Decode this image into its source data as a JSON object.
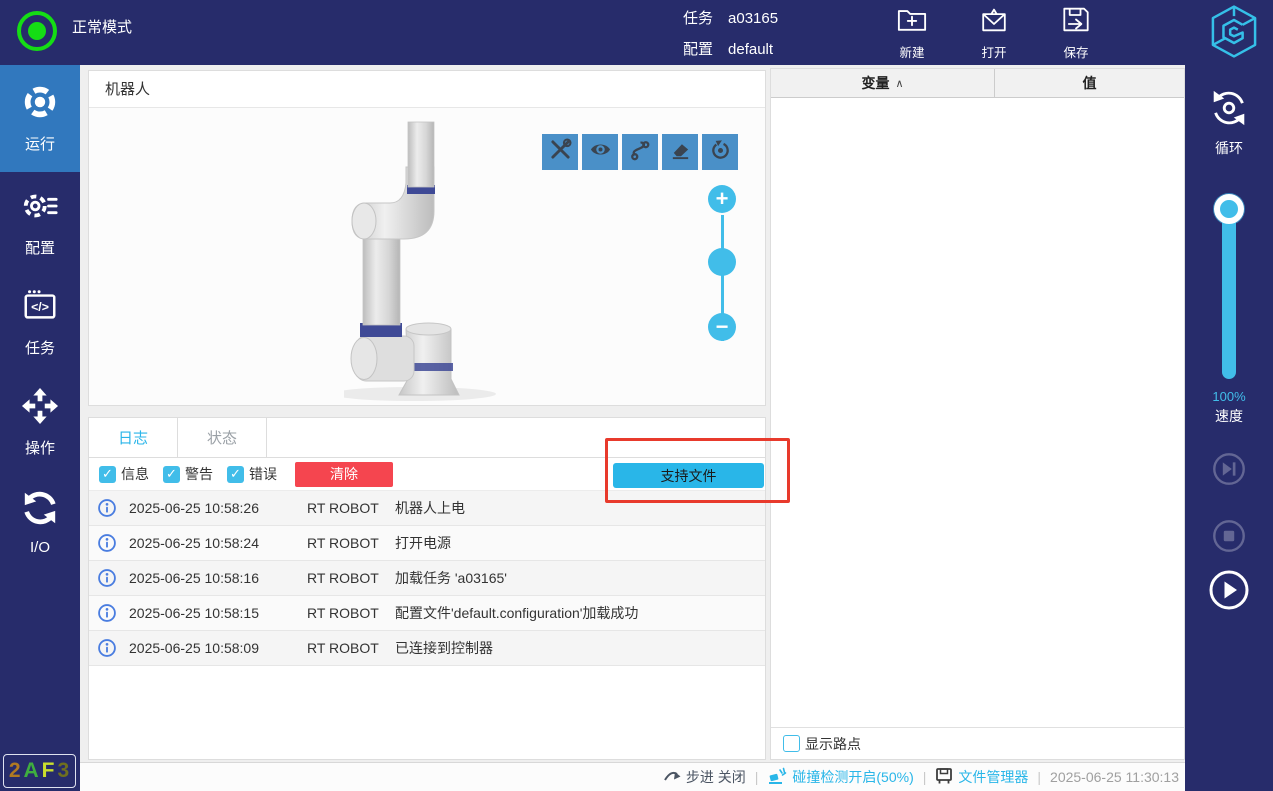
{
  "topbar": {
    "mode_label": "正常模式",
    "task_label": "任务",
    "task_value": "a03165",
    "config_label": "配置",
    "config_value": "default",
    "actions": [
      {
        "label": "新建"
      },
      {
        "label": "打开"
      },
      {
        "label": "保存"
      }
    ]
  },
  "sidebar": {
    "items": [
      {
        "label": "运行",
        "active": true
      },
      {
        "label": "配置",
        "active": false
      },
      {
        "label": "任务",
        "active": false
      },
      {
        "label": "操作",
        "active": false
      },
      {
        "label": "I/O",
        "active": false
      }
    ],
    "badge_chars": [
      {
        "ch": "2",
        "color": "#b07a22"
      },
      {
        "ch": "A",
        "color": "#3fae3f"
      },
      {
        "ch": "F",
        "color": "#cade2e"
      },
      {
        "ch": "3",
        "color": "#6f6f20"
      }
    ]
  },
  "robot_panel": {
    "title": "机器人",
    "toolbar_icons": [
      "tools",
      "eye",
      "path",
      "eraser",
      "rotate"
    ]
  },
  "log_panel": {
    "tabs": [
      {
        "label": "日志",
        "active": true
      },
      {
        "label": "状态",
        "active": false
      }
    ],
    "filters": [
      {
        "label": "信息",
        "checked": true
      },
      {
        "label": "警告",
        "checked": true
      },
      {
        "label": "错误",
        "checked": true
      }
    ],
    "clear_label": "清除",
    "support_label": "支持文件",
    "entries": [
      {
        "time": "2025-06-25 10:58:26",
        "source": "RT ROBOT",
        "message": "机器人上电"
      },
      {
        "time": "2025-06-25 10:58:24",
        "source": "RT ROBOT",
        "message": "打开电源"
      },
      {
        "time": "2025-06-25 10:58:16",
        "source": "RT ROBOT",
        "message": "加载任务 'a03165'"
      },
      {
        "time": "2025-06-25 10:58:15",
        "source": "RT ROBOT",
        "message": "配置文件'default.configuration'加载成功"
      },
      {
        "time": "2025-06-25 10:58:09",
        "source": "RT ROBOT",
        "message": "已连接到控制器"
      }
    ]
  },
  "variables_panel": {
    "columns": [
      {
        "label": "变量"
      },
      {
        "label": "值"
      }
    ],
    "sort_caret": "∧",
    "show_waypoints_label": "显示路点",
    "show_waypoints_checked": false
  },
  "right_sidebar": {
    "loop_label": "循环",
    "speed_percent": "100%",
    "speed_label": "速度",
    "transport": {
      "skip_enabled": false,
      "stop_enabled": false,
      "play_enabled": true
    }
  },
  "statusbar": {
    "step_label": "步进 关闭",
    "collision_label": "碰撞检测开启(50%)",
    "file_manager_label": "文件管理器",
    "timestamp": "2025-06-25 11:30:13",
    "sep": "|"
  },
  "colors": {
    "navy": "#272c6b",
    "active_blue": "#3178be",
    "cyan": "#29b6e8",
    "slider_cyan": "#41bde9",
    "toolbar_blue": "#4a90c8",
    "clear_red": "#f5454f",
    "annotation_red": "#e83a2c",
    "status_ok_green": "#15dd15",
    "info_blue": "#4a7de0",
    "joint_band_blue": "#3f4a96"
  }
}
